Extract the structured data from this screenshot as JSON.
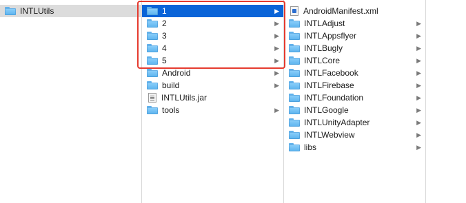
{
  "columns": [
    {
      "items": [
        {
          "label": "INTLUtils",
          "kind": "folder",
          "icon": "folder-icon",
          "has_children": false,
          "state": "parent-selected"
        }
      ]
    },
    {
      "items": [
        {
          "label": "1",
          "kind": "folder",
          "icon": "folder-icon",
          "has_children": true,
          "state": "selected"
        },
        {
          "label": "2",
          "kind": "folder",
          "icon": "folder-icon",
          "has_children": true,
          "state": ""
        },
        {
          "label": "3",
          "kind": "folder",
          "icon": "folder-icon",
          "has_children": true,
          "state": ""
        },
        {
          "label": "4",
          "kind": "folder",
          "icon": "folder-icon",
          "has_children": true,
          "state": ""
        },
        {
          "label": "5",
          "kind": "folder",
          "icon": "folder-icon",
          "has_children": true,
          "state": ""
        },
        {
          "label": "Android",
          "kind": "folder",
          "icon": "folder-icon",
          "has_children": true,
          "state": ""
        },
        {
          "label": "build",
          "kind": "folder",
          "icon": "folder-icon",
          "has_children": true,
          "state": ""
        },
        {
          "label": "INTLUtils.jar",
          "kind": "file",
          "icon": "jar-file-icon",
          "file_type": "jar",
          "has_children": false,
          "state": ""
        },
        {
          "label": "tools",
          "kind": "folder",
          "icon": "folder-icon",
          "has_children": true,
          "state": ""
        }
      ]
    },
    {
      "items": [
        {
          "label": "AndroidManifest.xml",
          "kind": "file",
          "icon": "xml-file-icon",
          "file_type": "xml",
          "has_children": false,
          "state": ""
        },
        {
          "label": "INTLAdjust",
          "kind": "folder",
          "icon": "folder-icon",
          "has_children": true,
          "state": ""
        },
        {
          "label": "INTLAppsflyer",
          "kind": "folder",
          "icon": "folder-icon",
          "has_children": true,
          "state": ""
        },
        {
          "label": "INTLBugly",
          "kind": "folder",
          "icon": "folder-icon",
          "has_children": true,
          "state": ""
        },
        {
          "label": "INTLCore",
          "kind": "folder",
          "icon": "folder-icon",
          "has_children": true,
          "state": ""
        },
        {
          "label": "INTLFacebook",
          "kind": "folder",
          "icon": "folder-icon",
          "has_children": true,
          "state": ""
        },
        {
          "label": "INTLFirebase",
          "kind": "folder",
          "icon": "folder-icon",
          "has_children": true,
          "state": ""
        },
        {
          "label": "INTLFoundation",
          "kind": "folder",
          "icon": "folder-icon",
          "has_children": true,
          "state": ""
        },
        {
          "label": "INTLGoogle",
          "kind": "folder",
          "icon": "folder-icon",
          "has_children": true,
          "state": ""
        },
        {
          "label": "INTLUnityAdapter",
          "kind": "folder",
          "icon": "folder-icon",
          "has_children": true,
          "state": ""
        },
        {
          "label": "INTLWebview",
          "kind": "folder",
          "icon": "folder-icon",
          "has_children": true,
          "state": ""
        },
        {
          "label": "libs",
          "kind": "folder",
          "icon": "folder-icon",
          "has_children": true,
          "state": ""
        }
      ]
    },
    {
      "items": []
    }
  ],
  "colors": {
    "selection": "#0a64d8",
    "parent_selection": "#dcdcdc",
    "annotation_box": "#e53a2e",
    "folder": "#5cb3ee"
  }
}
